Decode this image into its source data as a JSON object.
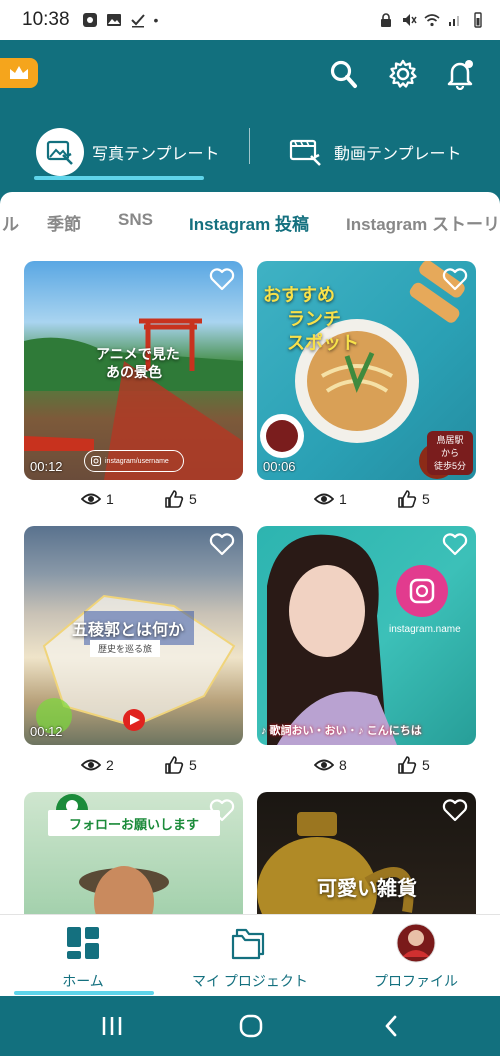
{
  "status_bar": {
    "time": "10:38"
  },
  "header": {
    "mode_tabs": [
      {
        "label": "写真テンプレート",
        "active": true
      },
      {
        "label": "動画テンプレート",
        "active": false
      }
    ]
  },
  "categories": [
    {
      "label": "ル",
      "active": false
    },
    {
      "label": "季節",
      "active": false
    },
    {
      "label": "SNS",
      "active": false
    },
    {
      "label": "Instagram 投稿",
      "active": true
    },
    {
      "label": "Instagram ストーリ",
      "active": false
    }
  ],
  "templates": [
    {
      "duration": "00:12",
      "views": "1",
      "likes": "5",
      "title_line1": "アニメで見た",
      "title_line2": "あの景色",
      "handle": "instagram/username"
    },
    {
      "duration": "00:06",
      "views": "1",
      "likes": "5",
      "title_line1": "おすすめ",
      "title_line2": "ランチ",
      "title_line3": "スポット",
      "badge1": "鳥居駅",
      "badge2": "から",
      "badge3": "徒歩5分"
    },
    {
      "duration": "00:12",
      "views": "2",
      "likes": "5",
      "title_line1": "五稜郭とは何か",
      "subtitle": "歴史を巡る旅"
    },
    {
      "duration": "",
      "views": "8",
      "likes": "5",
      "handle": "instagram.name",
      "caption": "♪ 歌詞おい・おい ･ ♪ こんにちは"
    },
    {
      "banner": "フォローお願いします"
    },
    {
      "title_line1": "可愛い雑貨"
    }
  ],
  "bottom_nav": [
    {
      "label": "ホーム",
      "active": true
    },
    {
      "label": "マイ プロジェクト",
      "active": false
    },
    {
      "label": "プロファイル",
      "active": false
    }
  ],
  "colors": {
    "primary": "#12707e",
    "accent_underline": "#5fd4ea",
    "premium": "#f5a51c",
    "active_text": "#14707f"
  }
}
